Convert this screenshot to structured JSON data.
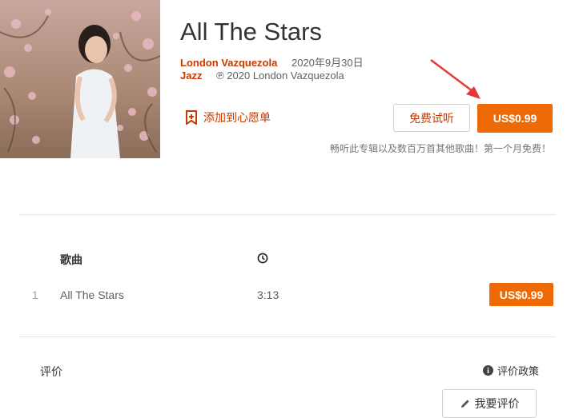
{
  "album": {
    "title": "All The Stars",
    "artist": "London Vazquezola",
    "release_date": "2020年9月30日",
    "genre": "Jazz",
    "copyright": "℗ 2020 London Vazquezola"
  },
  "actions": {
    "wishlist_label": "添加到心愿单",
    "free_trial_label": "免费试听",
    "buy_label": "US$0.99",
    "promo_text": "畅听此专辑以及数百万首其他歌曲！第一个月免费！"
  },
  "tracklist": {
    "col_song": "歌曲",
    "tracks": [
      {
        "number": "1",
        "name": "All The Stars",
        "duration": "3:13",
        "price": "US$0.99"
      }
    ]
  },
  "reviews": {
    "label": "评价",
    "policy_label": "评价政策",
    "write_review_label": "我要评价"
  },
  "colors": {
    "accent": "#ee6a07",
    "link": "#c63a00",
    "annotation_arrow": "#e53935"
  },
  "icons": [
    "bookmark-plus-icon",
    "clock-icon",
    "info-icon",
    "pencil-icon",
    "annotation-arrow"
  ]
}
